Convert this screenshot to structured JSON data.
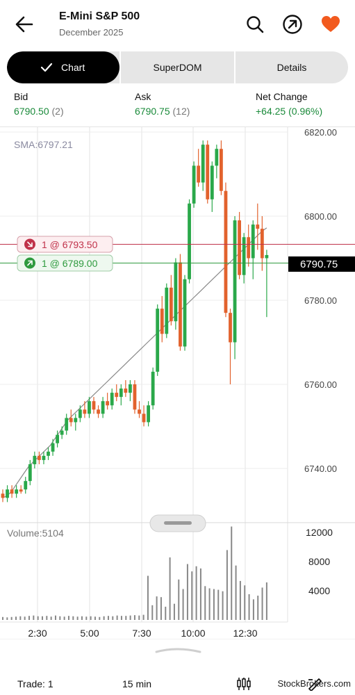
{
  "header": {
    "title": "E-Mini S&P 500",
    "subtitle": "December 2025",
    "icons": [
      "back-arrow-icon",
      "search-icon",
      "trade-arrow-icon",
      "heart-icon"
    ],
    "heart_color": "#f25a1e"
  },
  "tabs": [
    {
      "label": "Chart",
      "active": true,
      "check_icon": "checkmark-icon"
    },
    {
      "label": "SuperDOM",
      "active": false
    },
    {
      "label": "Details",
      "active": false
    }
  ],
  "quote": {
    "bid_label": "Bid",
    "bid_value": "6790.50",
    "bid_size": "(2)",
    "ask_label": "Ask",
    "ask_value": "6790.75",
    "ask_size": "(12)",
    "net_change_label": "Net Change",
    "net_change_value": "+64.25 (0.96%)"
  },
  "chart": {
    "sma_label": "SMA:6797.21",
    "volume_label": "Volume:5104",
    "last_price": "6790.75",
    "price_ticks": [
      "6820.00",
      "6800.00",
      "6780.00",
      "6760.00",
      "6740.00"
    ],
    "volume_ticks": [
      "12000",
      "8000",
      "4000"
    ],
    "time_ticks": [
      "2:30",
      "5:00",
      "7:30",
      "10:00",
      "12:30"
    ],
    "sell_order": "1 @ 6793.50",
    "buy_order": "1 @ 6789.00",
    "colors": {
      "up": "#2aa84a",
      "down": "#e2622d",
      "sell_line": "#c0324a",
      "buy_line": "#2e9a3e",
      "sma": "#888888",
      "volume": "#888888"
    }
  },
  "chart_data": {
    "type": "candlestick",
    "x_ticks": [
      "2:30",
      "5:00",
      "7:30",
      "10:00",
      "12:30"
    ],
    "ylim": [
      6731,
      6822
    ],
    "yticks": [
      6740,
      6760,
      6780,
      6800,
      6820
    ],
    "last_price": 6790.75,
    "sma": 6797.21,
    "volume_last": 5104,
    "volume_ylim": [
      0,
      13500
    ],
    "volume_yticks": [
      4000,
      8000,
      12000
    ],
    "sma_series": [
      6733,
      6733.5,
      6734.5,
      6736,
      6737.5,
      6739,
      6740.5,
      6741.5,
      6742.5,
      6743.5,
      6744.5,
      6745.5,
      6747,
      6748.5,
      6750,
      6751.5,
      6752.5,
      6753.5,
      6754.5,
      6755.5,
      6756.5,
      6757.5,
      6758.5,
      6759.5,
      6760.5,
      6761.5,
      6762.5,
      6763.5,
      6764.5,
      6765.5,
      6766.5,
      6767.5,
      6768.5,
      6769.5,
      6770.5,
      6771.5,
      6772.5,
      6773.5,
      6774.5,
      6775.5,
      6776.5,
      6777.5,
      6778.5,
      6779.5,
      6780.5,
      6781.5,
      6782.5,
      6783.5,
      6784.5,
      6785.5,
      6786.5,
      6787.5,
      6788.5,
      6789.5,
      6790.5,
      6791.5,
      6792.5,
      6793.5,
      6794.5,
      6795.5,
      6796.5,
      6797.21
    ],
    "ohlc": [
      [
        6734,
        6735,
        6732,
        6733
      ],
      [
        6733,
        6736,
        6732,
        6735
      ],
      [
        6735,
        6736,
        6733,
        6734
      ],
      [
        6734,
        6736,
        6733,
        6735
      ],
      [
        6735,
        6736,
        6734,
        6734.5
      ],
      [
        6735,
        6738,
        6734,
        6737
      ],
      [
        6737,
        6742,
        6736,
        6741
      ],
      [
        6741,
        6744,
        6740,
        6743
      ],
      [
        6743,
        6744,
        6741,
        6742
      ],
      [
        6742,
        6744,
        6741,
        6743
      ],
      [
        6743,
        6745,
        6742,
        6744
      ],
      [
        6744,
        6747,
        6743,
        6746
      ],
      [
        6746,
        6749,
        6745,
        6748
      ],
      [
        6748,
        6750,
        6747,
        6749
      ],
      [
        6749,
        6753,
        6748,
        6752
      ],
      [
        6752,
        6754,
        6750,
        6751
      ],
      [
        6751,
        6753,
        6749,
        6752
      ],
      [
        6752,
        6755,
        6751,
        6754
      ],
      [
        6754,
        6756,
        6752,
        6753
      ],
      [
        6753,
        6757,
        6752,
        6756
      ],
      [
        6756,
        6757,
        6753,
        6754
      ],
      [
        6754,
        6755,
        6752,
        6753
      ],
      [
        6753,
        6757,
        6752,
        6756
      ],
      [
        6756,
        6758,
        6754,
        6755
      ],
      [
        6755,
        6759,
        6754,
        6758
      ],
      [
        6758,
        6760,
        6756,
        6757
      ],
      [
        6757,
        6760,
        6755,
        6759
      ],
      [
        6759,
        6761,
        6757,
        6758
      ],
      [
        6758,
        6761,
        6756,
        6760
      ],
      [
        6760,
        6761,
        6753,
        6754
      ],
      [
        6754,
        6756,
        6752,
        6753
      ],
      [
        6753,
        6755,
        6750,
        6751
      ],
      [
        6751,
        6756,
        6750,
        6755
      ],
      [
        6755,
        6764,
        6754,
        6763
      ],
      [
        6763,
        6779,
        6762,
        6778
      ],
      [
        6778,
        6781,
        6770,
        6772
      ],
      [
        6772,
        6784,
        6771,
        6783
      ],
      [
        6783,
        6786,
        6774,
        6775
      ],
      [
        6775,
        6790,
        6773,
        6789
      ],
      [
        6789,
        6791,
        6768,
        6769
      ],
      [
        6769,
        6786,
        6768,
        6785
      ],
      [
        6785,
        6804,
        6784,
        6803
      ],
      [
        6803,
        6813,
        6802,
        6812
      ],
      [
        6812,
        6816,
        6807,
        6808
      ],
      [
        6808,
        6818,
        6806,
        6817
      ],
      [
        6817,
        6818,
        6803,
        6804
      ],
      [
        6804,
        6813,
        6801,
        6812
      ],
      [
        6812,
        6817,
        6809,
        6816
      ],
      [
        6816,
        6818,
        6805,
        6806
      ],
      [
        6806,
        6808,
        6776,
        6777
      ],
      [
        6777,
        6778,
        6760,
        6770
      ],
      [
        6770,
        6800,
        6766,
        6799
      ],
      [
        6799,
        6801,
        6785,
        6786
      ],
      [
        6786,
        6796,
        6784,
        6795
      ],
      [
        6795,
        6798,
        6788,
        6790
      ],
      [
        6790,
        6799,
        6785,
        6798
      ],
      [
        6798,
        6803,
        6792,
        6797
      ],
      [
        6797,
        6800,
        6787,
        6790
      ],
      [
        6790,
        6792,
        6776,
        6790.75
      ]
    ],
    "volume": [
      400,
      350,
      400,
      450,
      500,
      450,
      550,
      600,
      500,
      500,
      550,
      450,
      600,
      500,
      450,
      550,
      500,
      450,
      500,
      450,
      500,
      450,
      400,
      500,
      550,
      500,
      600,
      550,
      550,
      600,
      650,
      600,
      700,
      6000,
      2000,
      3200,
      3100,
      1800,
      8500,
      2200,
      5500,
      4200,
      7600,
      6600,
      7300,
      7000,
      4600,
      4300,
      4200,
      4100,
      3900,
      9500,
      12700,
      7400,
      5300,
      4700,
      3500,
      2800,
      3300,
      4400,
      5104
    ]
  }
}
